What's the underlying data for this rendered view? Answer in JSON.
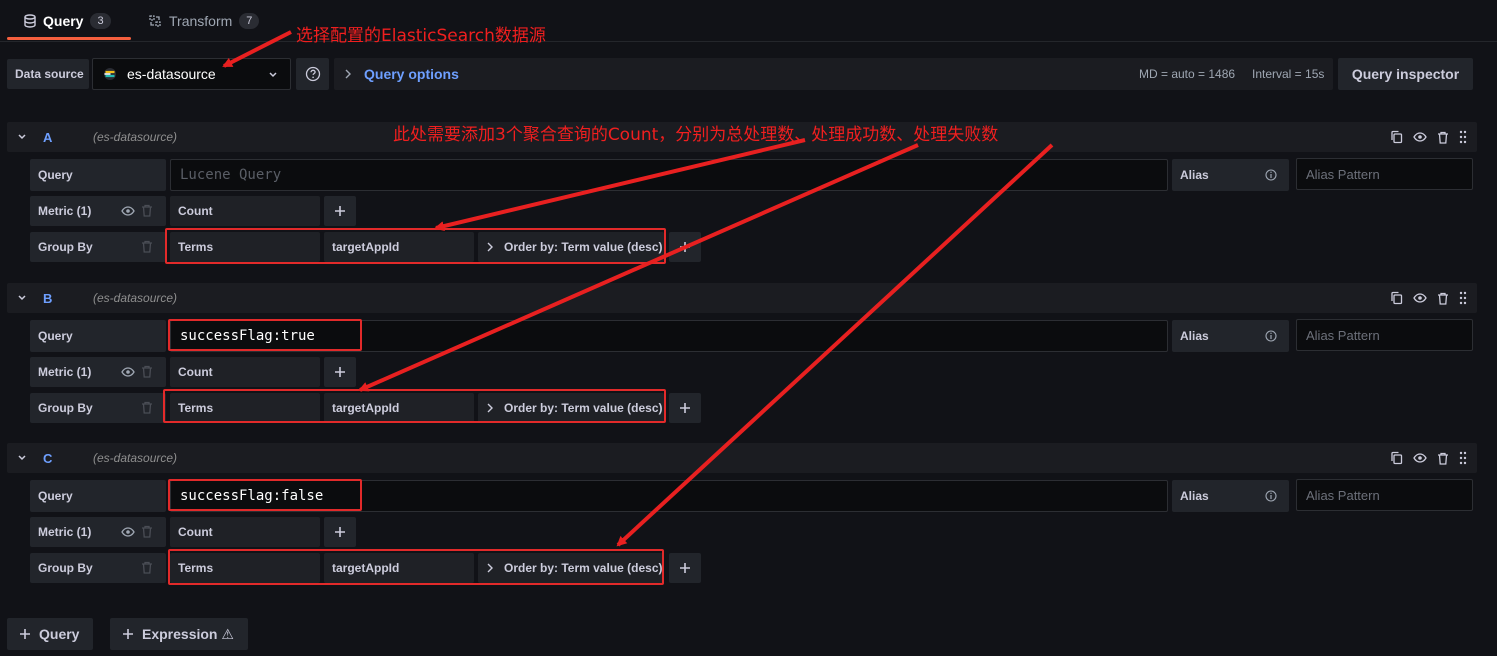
{
  "tabs": [
    {
      "label": "Query",
      "count": "3",
      "icon": "database-icon"
    },
    {
      "label": "Transform",
      "count": "7",
      "icon": "transform-icon"
    }
  ],
  "toolbar": {
    "data_source_label": "Data source",
    "data_source_value": "es-datasource",
    "query_options_label": "Query options",
    "md_info": "MD = auto = 1486",
    "interval_info": "Interval = 15s",
    "query_inspector_label": "Query inspector"
  },
  "queries": [
    {
      "letter": "A",
      "datasource": "(es-datasource)",
      "query_label": "Query",
      "query_value": "",
      "query_placeholder": "Lucene Query",
      "alias_label": "Alias",
      "alias_placeholder": "Alias Pattern",
      "metric_label": "Metric (1)",
      "metric_value": "Count",
      "groupby_label": "Group By",
      "groupby_type": "Terms",
      "groupby_field": "targetAppId",
      "groupby_order": "Order by: Term value (desc)"
    },
    {
      "letter": "B",
      "datasource": "(es-datasource)",
      "query_label": "Query",
      "query_value": "successFlag:true",
      "query_placeholder": "",
      "alias_label": "Alias",
      "alias_placeholder": "Alias Pattern",
      "metric_label": "Metric (1)",
      "metric_value": "Count",
      "groupby_label": "Group By",
      "groupby_type": "Terms",
      "groupby_field": "targetAppId",
      "groupby_order": "Order by: Term value (desc)"
    },
    {
      "letter": "C",
      "datasource": "(es-datasource)",
      "query_label": "Query",
      "query_value": "successFlag:false",
      "query_placeholder": "",
      "alias_label": "Alias",
      "alias_placeholder": "Alias Pattern",
      "metric_label": "Metric (1)",
      "metric_value": "Count",
      "groupby_label": "Group By",
      "groupby_type": "Terms",
      "groupby_field": "targetAppId",
      "groupby_order": "Order by: Term value (desc)"
    }
  ],
  "bottom": {
    "add_query_label": "Query",
    "add_expression_label": "Expression ⚠"
  },
  "annotations": {
    "datasource_note": "选择配置的ElasticSearch数据源",
    "aggregation_note": "此处需要添加3个聚合查询的Count，分别为总处理数、处理成功数、处理失败数"
  },
  "colors": {
    "background": "#111217",
    "accent_tab": "#f55f3e",
    "query_letter": "#6e9fff",
    "annotation_red": "#f01f1f"
  }
}
